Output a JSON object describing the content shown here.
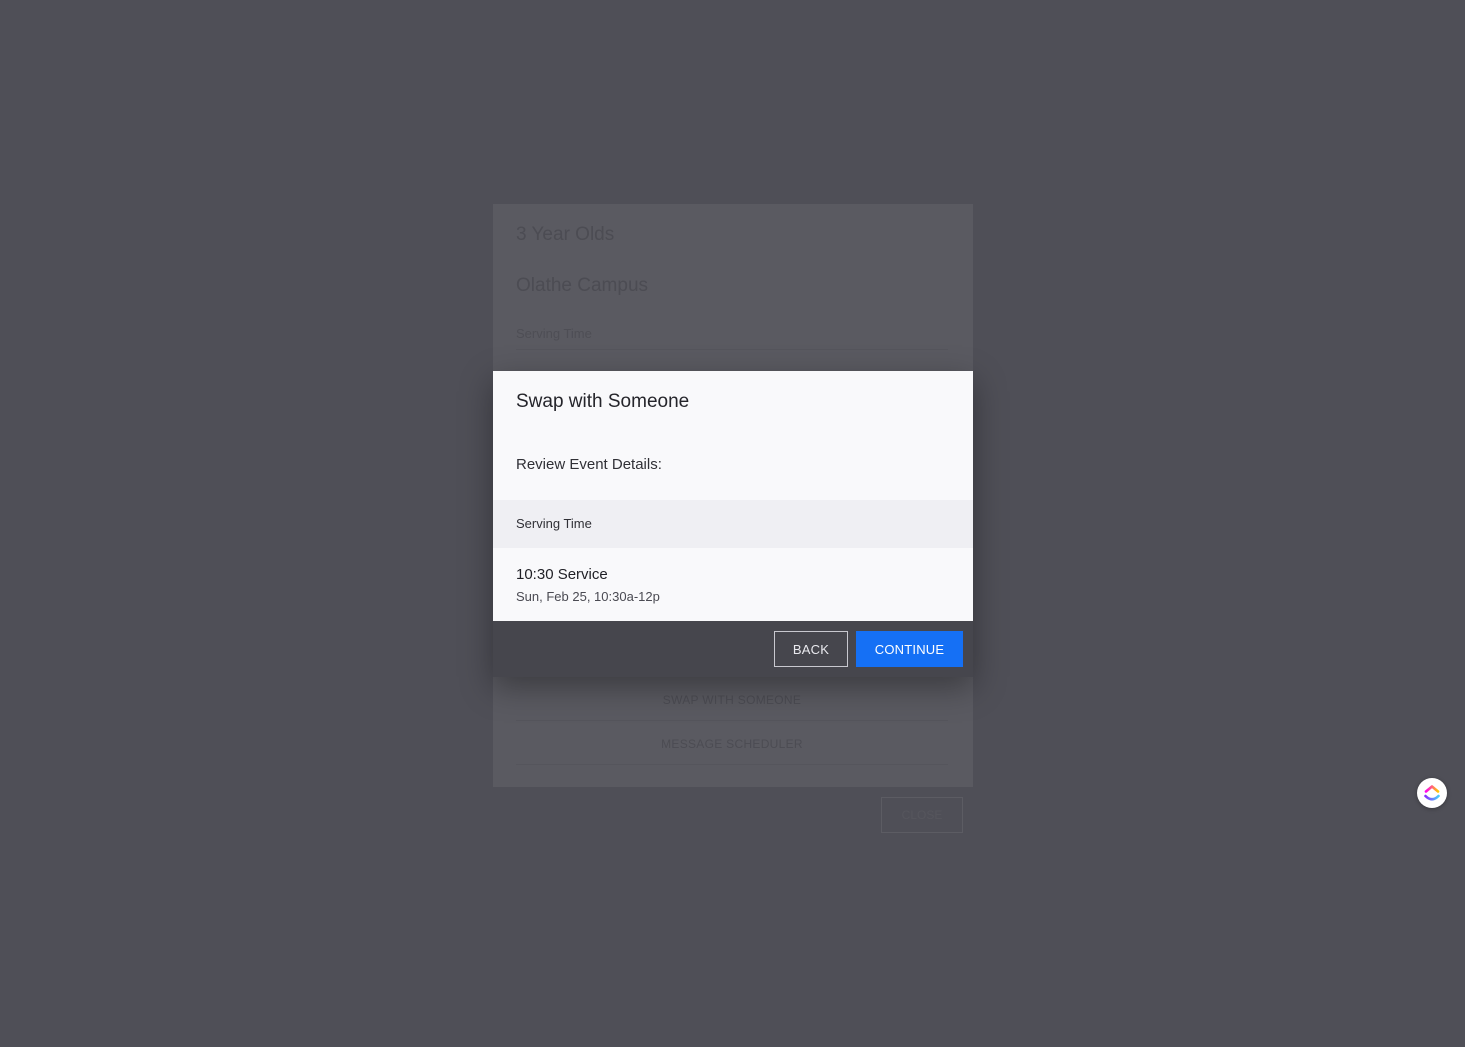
{
  "background": {
    "title": "3 Year Olds",
    "campus": "Olathe Campus",
    "serving_time_label": "Serving Time",
    "actions": [
      "SWAP WITH SOMEONE",
      "MESSAGE SCHEDULER"
    ],
    "close_label": "CLOSE"
  },
  "modal": {
    "title": "Swap with Someone",
    "subtitle": "Review Event Details:",
    "section_label": "Serving Time",
    "event": {
      "name": "10:30 Service",
      "datetime": "Sun, Feb 25, 10:30a-12p"
    },
    "back_label": "BACK",
    "continue_label": "CONTINUE"
  },
  "colors": {
    "overlay": "#4f4f57",
    "accent": "#1570f5",
    "modal_footer": "#46464d"
  },
  "widget": {
    "icon": "clickup-logo-icon"
  }
}
